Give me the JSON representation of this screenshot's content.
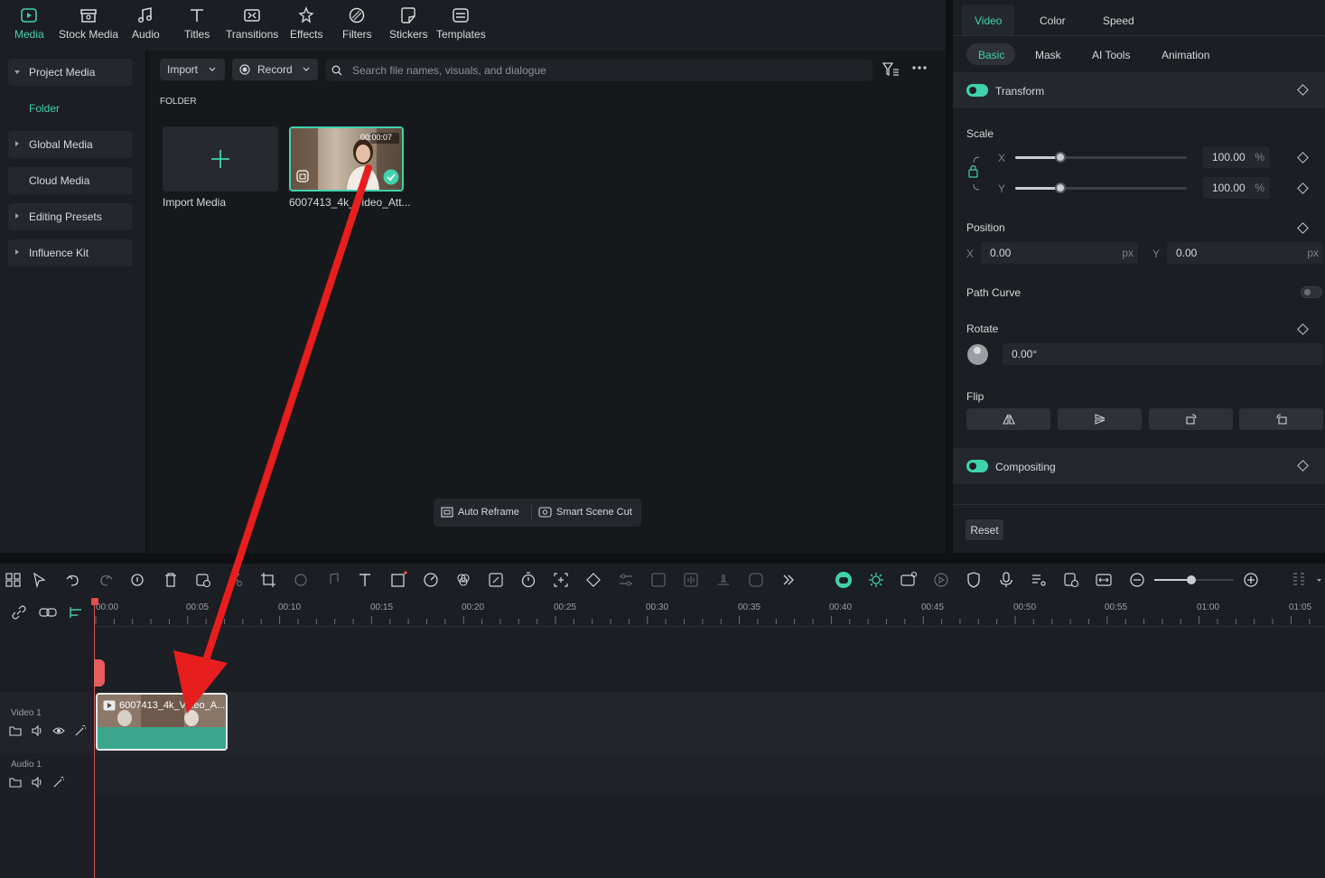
{
  "topbar": {
    "tools": [
      {
        "label": "Media",
        "icon": "media-icon",
        "active": true
      },
      {
        "label": "Stock Media",
        "icon": "stock-media-icon"
      },
      {
        "label": "Audio",
        "icon": "music-note-icon"
      },
      {
        "label": "Titles",
        "icon": "text-t-icon"
      },
      {
        "label": "Transitions",
        "icon": "transitions-icon"
      },
      {
        "label": "Effects",
        "icon": "effects-icon"
      },
      {
        "label": "Filters",
        "icon": "filters-icon"
      },
      {
        "label": "Stickers",
        "icon": "stickers-icon"
      },
      {
        "label": "Templates",
        "icon": "templates-icon"
      }
    ]
  },
  "leftnav": {
    "project_media": "Project Media",
    "folder": "Folder",
    "global_media": "Global Media",
    "cloud_media": "Cloud Media",
    "editing_presets": "Editing Presets",
    "influence_kit": "Influence Kit"
  },
  "media": {
    "import_label": "Import",
    "record_label": "Record",
    "search_placeholder": "Search file names, visuals, and dialogue",
    "folder_heading": "FOLDER",
    "import_media_label": "Import Media",
    "clip_name": "6007413_4k_Video_Att...",
    "clip_duration": "00:00:07",
    "auto_reframe": "Auto Reframe",
    "smart_scene_cut": "Smart Scene Cut"
  },
  "rpanel": {
    "tabs": [
      "Video",
      "Color",
      "Speed"
    ],
    "subtabs": [
      "Basic",
      "Mask",
      "AI Tools",
      "Animation"
    ],
    "transform": "Transform",
    "scale": "Scale",
    "scale_x_label": "X",
    "scale_y_label": "Y",
    "scale_x": "100.00",
    "scale_y": "100.00",
    "percent": "%",
    "position": "Position",
    "pos_x_label": "X",
    "pos_y_label": "Y",
    "pos_x": "0.00",
    "pos_y": "0.00",
    "px": "px",
    "path_curve": "Path Curve",
    "rotate": "Rotate",
    "rotate_value": "0.00°",
    "flip": "Flip",
    "compositing": "Compositing",
    "reset": "Reset",
    "accent": "#3fd3ad"
  },
  "timeline": {
    "ruler": [
      "00:00",
      "00:05",
      "00:10",
      "00:15",
      "00:20",
      "00:25",
      "00:30",
      "00:35",
      "00:40",
      "00:45",
      "00:50",
      "00:55",
      "01:00",
      "01:05"
    ],
    "video_track": "Video 1",
    "audio_track": "Audio 1",
    "clip_label": "6007413_4k_Video_A..."
  }
}
